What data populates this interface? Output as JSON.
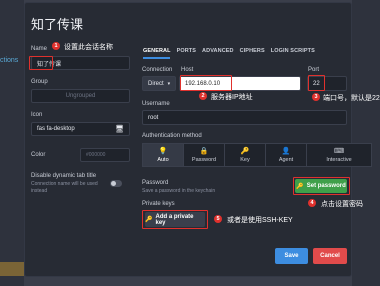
{
  "dialog": {
    "title": "知了传课",
    "name_label": "Name",
    "name_value": "知了传课",
    "group_label": "Group",
    "group_placeholder": "Ungrouped",
    "icon_label": "Icon",
    "icon_value": "fas fa-desktop",
    "color_label": "Color",
    "color_value": "#000000",
    "disable_tab_title_label": "Disable dynamic tab title",
    "disable_tab_title_desc_1": "Connection name will be used",
    "disable_tab_title_desc_2": "instead"
  },
  "tabs": [
    "GENERAL",
    "PORTS",
    "ADVANCED",
    "CIPHERS",
    "LOGIN SCRIPTS"
  ],
  "general": {
    "connection_label": "Connection",
    "connection_value": "Direct",
    "host_label": "Host",
    "host_value": "192.168.0.10",
    "port_label": "Port",
    "port_value": "22",
    "username_label": "Username",
    "username_value": "root",
    "auth_method_label": "Authentication method",
    "auth_methods": [
      {
        "label": "Auto",
        "icon": "bulb-icon",
        "glyph": "💡"
      },
      {
        "label": "Password",
        "icon": "lock-icon",
        "glyph": "🔒"
      },
      {
        "label": "Key",
        "icon": "key-icon",
        "glyph": "🔑"
      },
      {
        "label": "Agent",
        "icon": "agent-icon",
        "glyph": "👤"
      },
      {
        "label": "Interactive",
        "icon": "keyboard-icon",
        "glyph": "⌨"
      }
    ],
    "password_label": "Password",
    "password_desc": "Save a password in the keychain",
    "set_password_button": "Set password",
    "private_keys_label": "Private keys",
    "add_private_key_button": "Add a private key"
  },
  "footer": {
    "save_button": "Save",
    "cancel_button": "Cancel"
  },
  "annotations": {
    "a1_num": "1",
    "a1_text": "设置此会话名称",
    "a2_num": "2",
    "a2_text": "服务器IP地址",
    "a3_num": "3",
    "a3_text": "端口号，默认是22",
    "a4_num": "4",
    "a4_text": "点击设置密码",
    "a5_num": "5",
    "a5_text": "或者是使用SSH-KEY"
  },
  "background": {
    "left_text": "ctions"
  },
  "colors": {
    "accent_blue": "#3d8de0",
    "green": "#3fa04a",
    "red": "#e14b4b",
    "annotation_red": "#e0312d"
  }
}
